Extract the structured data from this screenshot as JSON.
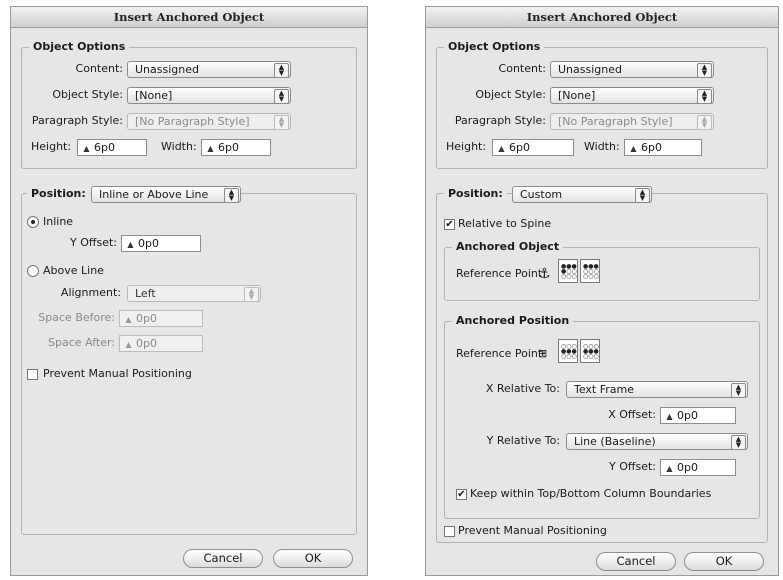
{
  "left": {
    "title": "Insert Anchored Object",
    "object_options": {
      "legend": "Object Options",
      "content_label": "Content:",
      "content_value": "Unassigned",
      "object_style_label": "Object Style:",
      "object_style_value": "[None]",
      "paragraph_style_label": "Paragraph Style:",
      "paragraph_style_value": "[No Paragraph Style]",
      "height_label": "Height:",
      "height_value": "6p0",
      "width_label": "Width:",
      "width_value": "6p0"
    },
    "position": {
      "label": "Position:",
      "value": "Inline or Above Line",
      "inline_label": "Inline",
      "y_offset_label": "Y Offset:",
      "y_offset_value": "0p0",
      "above_line_label": "Above Line",
      "alignment_label": "Alignment:",
      "alignment_value": "Left",
      "space_before_label": "Space Before:",
      "space_before_value": "0p0",
      "space_after_label": "Space After:",
      "space_after_value": "0p0"
    },
    "prevent_label": "Prevent Manual Positioning",
    "cancel_label": "Cancel",
    "ok_label": "OK"
  },
  "right": {
    "title": "Insert Anchored Object",
    "object_options": {
      "legend": "Object Options",
      "content_label": "Content:",
      "content_value": "Unassigned",
      "object_style_label": "Object Style:",
      "object_style_value": "[None]",
      "paragraph_style_label": "Paragraph Style:",
      "paragraph_style_value": "[No Paragraph Style]",
      "height_label": "Height:",
      "height_value": "6p0",
      "width_label": "Width:",
      "width_value": "6p0"
    },
    "position": {
      "label": "Position:",
      "value": "Custom",
      "relative_to_spine_label": "Relative to Spine",
      "anchored_object_legend": "Anchored Object",
      "ao_reference_point_label": "Reference Point:",
      "anchored_position_legend": "Anchored Position",
      "ap_reference_point_label": "Reference Point:",
      "x_relative_label": "X Relative To:",
      "x_relative_value": "Text Frame",
      "x_offset_label": "X Offset:",
      "x_offset_value": "0p0",
      "y_relative_label": "Y Relative To:",
      "y_relative_value": "Line (Baseline)",
      "y_offset_label": "Y Offset:",
      "y_offset_value": "0p0",
      "keep_within_label": "Keep within Top/Bottom Column Boundaries"
    },
    "prevent_label": "Prevent Manual Positioning",
    "cancel_label": "Cancel",
    "ok_label": "OK"
  },
  "icons": {
    "spinner": "up-down-spinner-icon",
    "popup_arrows": "popup-arrows-icon",
    "anchor": "anchor-icon",
    "reference_point": "reference-point-grid-icon",
    "spread_toggle": "spread-pages-icon"
  }
}
